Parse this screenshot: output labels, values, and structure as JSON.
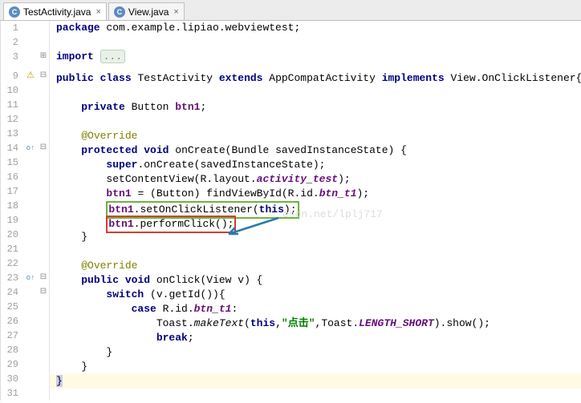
{
  "tabs": [
    {
      "label": "TestActivity.java",
      "icon": "C",
      "active": true
    },
    {
      "label": "View.java",
      "icon": "C",
      "active": false
    }
  ],
  "lines": {
    "l1": {
      "num": "1",
      "fold": "",
      "gicon": ""
    },
    "l2": {
      "num": "2",
      "fold": "",
      "gicon": ""
    },
    "l3": {
      "num": "3",
      "fold": "+",
      "gicon": ""
    },
    "l9": {
      "num": "9",
      "fold": "-",
      "gicon": "warn"
    },
    "l10": {
      "num": "10",
      "fold": "",
      "gicon": ""
    },
    "l11": {
      "num": "11",
      "fold": "",
      "gicon": ""
    },
    "l12": {
      "num": "12",
      "fold": "",
      "gicon": ""
    },
    "l13": {
      "num": "13",
      "fold": "",
      "gicon": ""
    },
    "l14": {
      "num": "14",
      "fold": "-",
      "gicon": "ov"
    },
    "l15": {
      "num": "15",
      "fold": "",
      "gicon": ""
    },
    "l16": {
      "num": "16",
      "fold": "",
      "gicon": ""
    },
    "l17": {
      "num": "17",
      "fold": "",
      "gicon": ""
    },
    "l18": {
      "num": "18",
      "fold": "",
      "gicon": ""
    },
    "l19": {
      "num": "19",
      "fold": "",
      "gicon": ""
    },
    "l20": {
      "num": "20",
      "fold": "",
      "gicon": ""
    },
    "l21": {
      "num": "21",
      "fold": "",
      "gicon": ""
    },
    "l22": {
      "num": "22",
      "fold": "",
      "gicon": ""
    },
    "l23": {
      "num": "23",
      "fold": "-",
      "gicon": "ov"
    },
    "l24": {
      "num": "24",
      "fold": "-",
      "gicon": ""
    },
    "l25": {
      "num": "25",
      "fold": "",
      "gicon": ""
    },
    "l26": {
      "num": "26",
      "fold": "",
      "gicon": ""
    },
    "l27": {
      "num": "27",
      "fold": "",
      "gicon": ""
    },
    "l28": {
      "num": "28",
      "fold": "",
      "gicon": ""
    },
    "l29": {
      "num": "29",
      "fold": "",
      "gicon": ""
    },
    "l30": {
      "num": "30",
      "fold": "",
      "gicon": ""
    },
    "l31": {
      "num": "31",
      "fold": "",
      "gicon": ""
    }
  },
  "code": {
    "pkg": "package",
    "pkgName": " com.example.lipiao.webviewtest;",
    "imp": "import",
    "impDots": "...",
    "pub": "public",
    "cls": "class",
    "clsName": " TestActivity ",
    "ext": "extends",
    "extName": " AppCompatActivity ",
    "impl": "implements",
    "implName": " View.OnClickListener",
    "lbrace": "{",
    "priv": "private",
    "btnType": " Button ",
    "btnFld": "btn1",
    "semi": ";",
    "override": "@Override",
    "prot": "protected",
    "vd": "void",
    "onCreate": " onCreate(Bundle savedInstanceState) {",
    "superCall": "super",
    "superRest": ".onCreate(savedInstanceState);",
    "setContent": "setContentView(R.layout.",
    "actTest": "activity_test",
    "closeParen": ");",
    "findView1": " = (Button) findViewById(R.id.",
    "btnT1": "btn_t1",
    "setListener1": ".setOnClickListener(",
    "thisKw": "this",
    "perform": ".performClick();",
    "rbrace": "}",
    "onClick": " onClick(View v) {",
    "switchKw": "switch",
    "switchCond": " (v.getId()){",
    "caseKw": "case",
    "caseVal": " R.id.",
    "colon": ":",
    "toastBeg": "Toast.",
    "makeText": "makeText",
    "toastMid": "(",
    "toastStr": "\"点击\"",
    "toastEnd": ",Toast.",
    "lenShort": "LENGTH_SHORT",
    "toastShow": ").show();",
    "breakKw": "break",
    "watermark": "csdn.net/lplj717"
  }
}
